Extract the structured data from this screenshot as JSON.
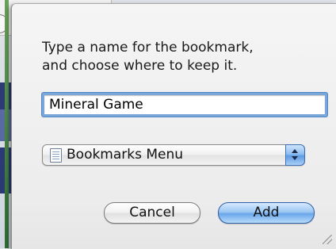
{
  "dialog": {
    "prompt_line1": "Type a name for the bookmark,",
    "prompt_line2": "and choose where to keep it.",
    "name_value": "Mineral Game",
    "folder": {
      "selected": "Bookmarks Menu",
      "icon": "bookmarks-folder-icon"
    },
    "cancel_label": "Cancel",
    "add_label": "Add"
  },
  "colors": {
    "focus_ring": "#7aa6d8",
    "default_button": "#6aa6ea"
  }
}
